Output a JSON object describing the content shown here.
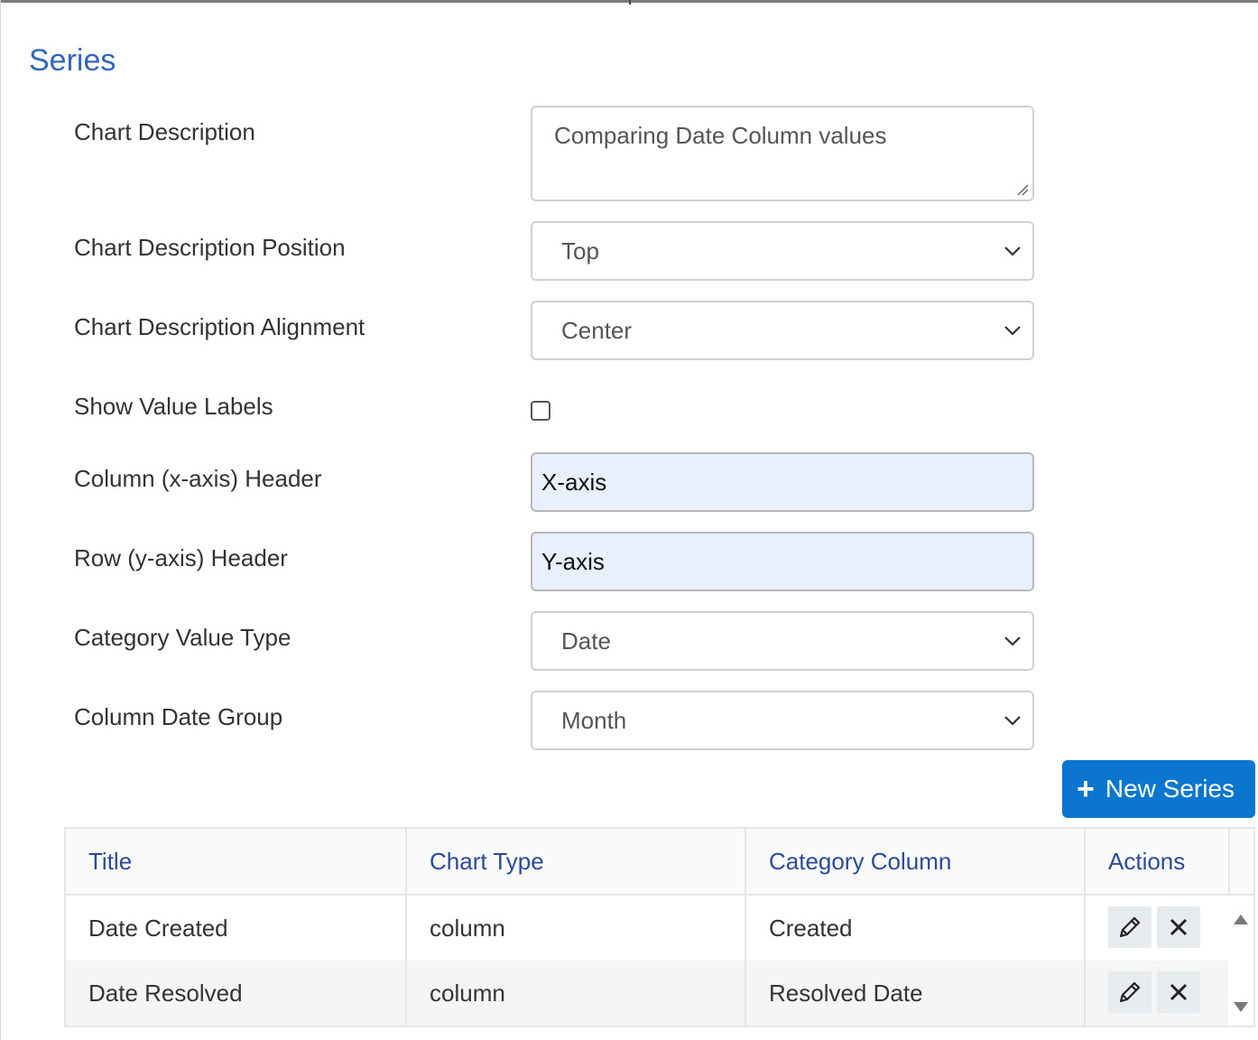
{
  "section": {
    "title": "Series"
  },
  "form": {
    "chart_description": {
      "label": "Chart Description",
      "value": "Comparing Date Column values"
    },
    "chart_description_position": {
      "label": "Chart Description Position",
      "value": "Top"
    },
    "chart_description_alignment": {
      "label": "Chart Description Alignment",
      "value": "Center"
    },
    "show_value_labels": {
      "label": "Show Value Labels",
      "checked": false
    },
    "column_header": {
      "label": "Column (x-axis) Header",
      "value": "X-axis"
    },
    "row_header": {
      "label": "Row (y-axis) Header",
      "value": "Y-axis"
    },
    "category_value_type": {
      "label": "Category Value Type",
      "value": "Date"
    },
    "column_date_group": {
      "label": "Column Date Group",
      "value": "Month"
    }
  },
  "toolbar": {
    "new_series_label": "New Series"
  },
  "grid": {
    "columns": [
      "Title",
      "Chart Type",
      "Category Column",
      "Actions"
    ],
    "rows": [
      {
        "title": "Date Created",
        "chart_type": "column",
        "category_column": "Created"
      },
      {
        "title": "Date Resolved",
        "chart_type": "column",
        "category_column": "Resolved Date"
      }
    ]
  },
  "colors": {
    "accent": "#0b76cf",
    "section_title": "#3366bb",
    "header_text": "#2a4a9b",
    "autofill_bg": "#e8f0fe"
  },
  "icons": [
    "plus-icon",
    "pencil-icon",
    "close-icon",
    "chevron-down-icon",
    "scroll-up-icon",
    "scroll-down-icon"
  ]
}
